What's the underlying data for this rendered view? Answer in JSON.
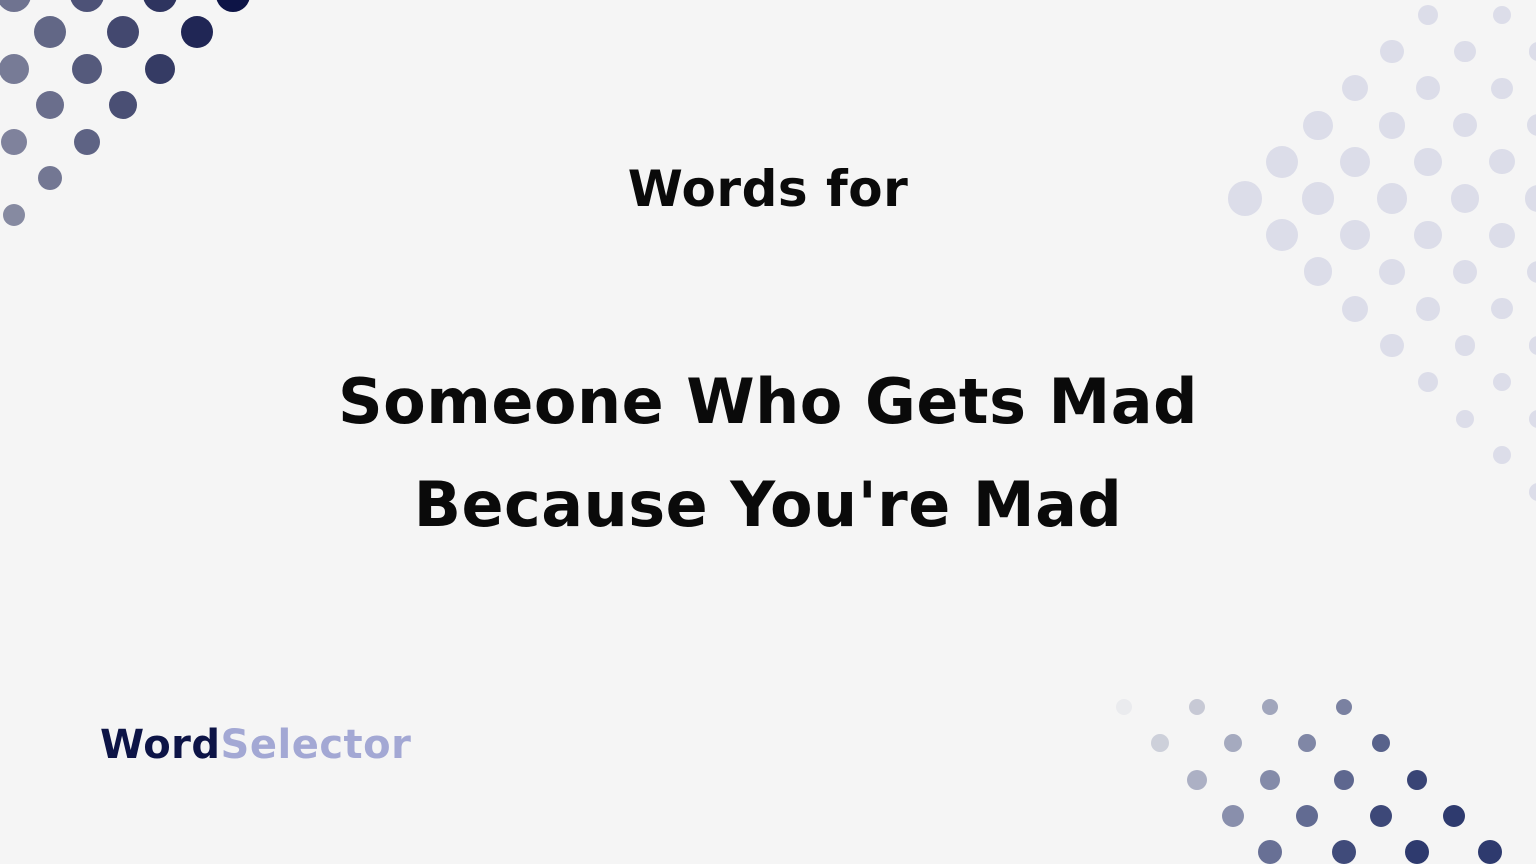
{
  "header": {
    "subtitle": "Words for"
  },
  "main": {
    "title_line1": "Someone Who Gets Mad",
    "title_line2": "Because You're Mad"
  },
  "brand": {
    "part1": "Word",
    "part2": "Selector",
    "color_primary": "#0d1446",
    "color_secondary": "#a3a8d4"
  },
  "decor": {
    "top_left_dot_color": "#0d1446",
    "top_right_dot_color": "#dcdde9",
    "bottom_right_dot_color": "#2e3a6e"
  }
}
